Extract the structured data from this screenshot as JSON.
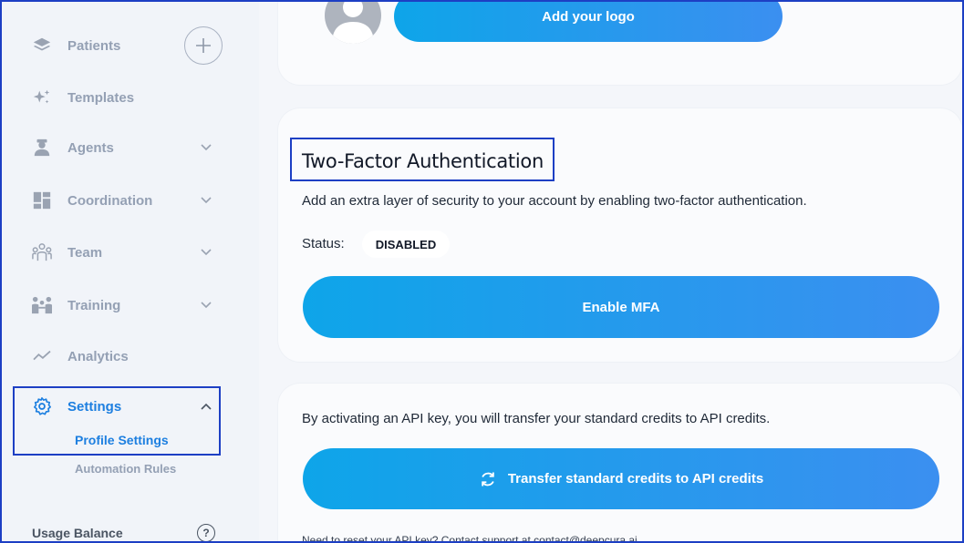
{
  "sidebar": {
    "items": [
      {
        "label": "Patients",
        "icon": "layers-icon"
      },
      {
        "label": "Templates",
        "icon": "sparkles-icon"
      },
      {
        "label": "Agents",
        "icon": "agent-icon"
      },
      {
        "label": "Coordination",
        "icon": "dashboard-icon"
      },
      {
        "label": "Team",
        "icon": "team-icon"
      },
      {
        "label": "Training",
        "icon": "training-icon"
      },
      {
        "label": "Analytics",
        "icon": "analytics-icon"
      },
      {
        "label": "Settings",
        "icon": "gear-icon"
      }
    ],
    "settings_sub": {
      "profile": "Profile Settings",
      "automation": "Automation Rules"
    },
    "usage_label": "Usage Balance",
    "help_glyph": "?"
  },
  "logo": {
    "button_label": "Add your logo"
  },
  "tfa": {
    "title": "Two-Factor Authentication",
    "description": "Add an extra layer of security to your account by enabling two-factor authentication.",
    "status_label": "Status:",
    "status_value": "DISABLED",
    "enable_button": "Enable MFA"
  },
  "api": {
    "description": "By activating an API key, you will transfer your standard credits to API credits.",
    "transfer_button": "Transfer standard credits to API credits",
    "reset_note": "Need to reset your API key? Contact support at contact@deepcura.ai"
  },
  "colors": {
    "accent": "#1d7fe0",
    "nav_muted": "#94a0b4",
    "highlight_border": "#1d3fc4"
  }
}
